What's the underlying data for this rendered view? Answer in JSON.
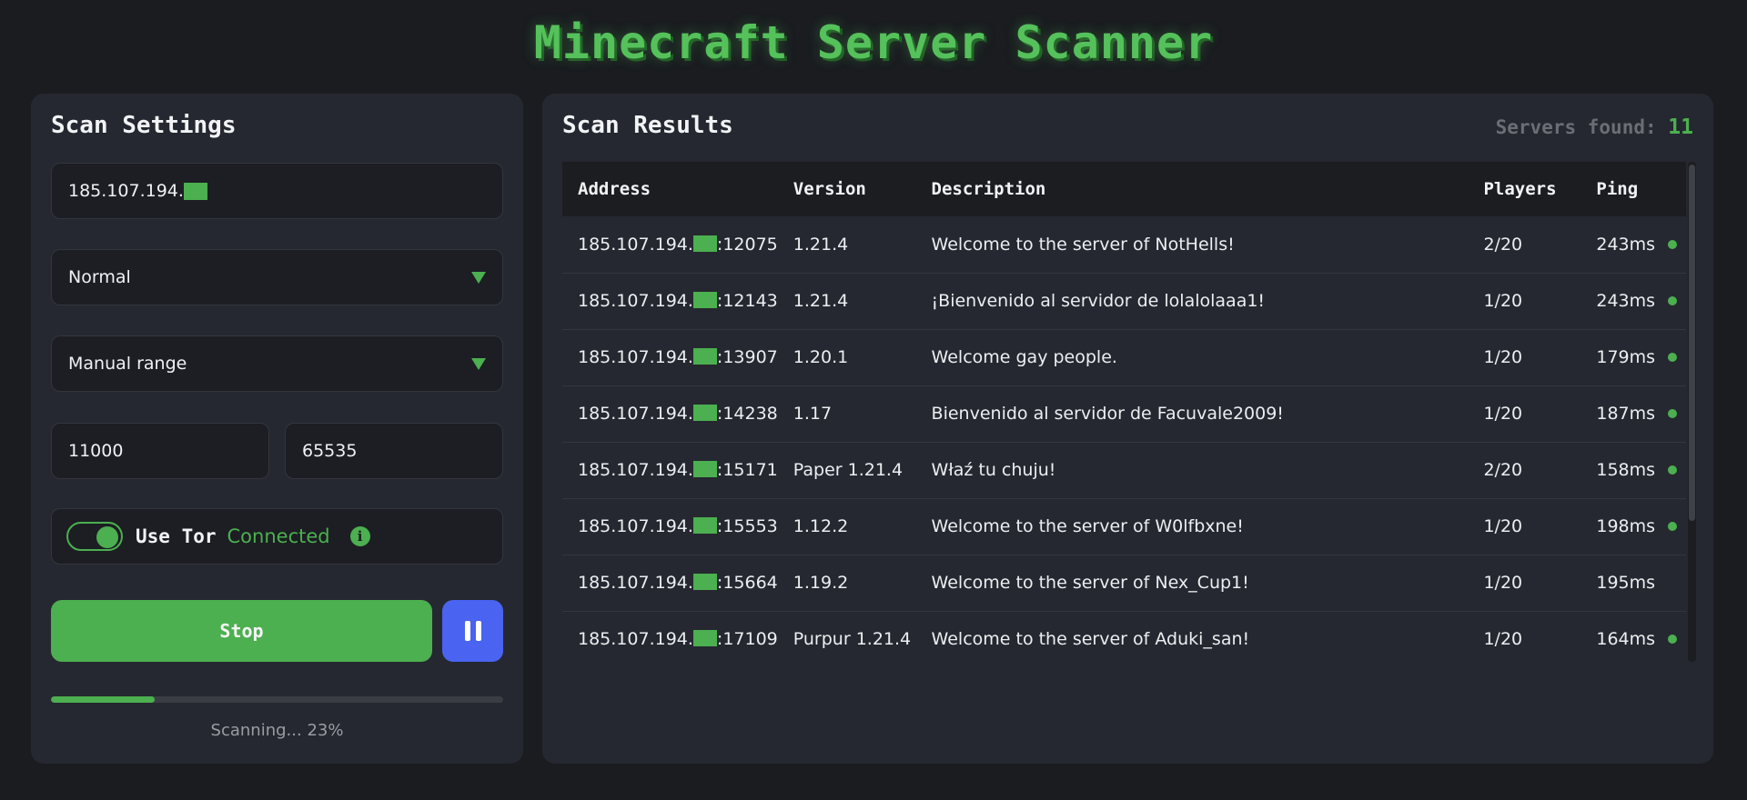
{
  "app": {
    "title": "Minecraft Server Scanner"
  },
  "settings": {
    "title": "Scan Settings",
    "ip_prefix": "185.107.194.",
    "mode": "Normal",
    "range_mode": "Manual range",
    "port_start": "11000",
    "port_end": "65535",
    "tor": {
      "label": "Use Tor",
      "status": "Connected",
      "enabled": true,
      "info_icon": "info-icon"
    },
    "stop_label": "Stop",
    "pause_icon": "pause-icon",
    "progress": {
      "percent": 23,
      "text": "Scanning... 23%"
    }
  },
  "results": {
    "title": "Scan Results",
    "found_label": "Servers found:",
    "found_count": "11",
    "columns": [
      "Address",
      "Version",
      "Description",
      "Players",
      "Ping"
    ],
    "rows": [
      {
        "addr_prefix": "185.107.194.",
        "port": ":12075",
        "version": "1.21.4",
        "description": "Welcome to the server of NotHells!",
        "players": "2/20",
        "ping": "243ms",
        "online": true
      },
      {
        "addr_prefix": "185.107.194.",
        "port": ":12143",
        "version": "1.21.4",
        "description": "¡Bienvenido al servidor de lolalolaaa1!",
        "players": "1/20",
        "ping": "243ms",
        "online": true
      },
      {
        "addr_prefix": "185.107.194.",
        "port": ":13907",
        "version": "1.20.1",
        "description": "Welcome gay people.",
        "players": "1/20",
        "ping": "179ms",
        "online": true
      },
      {
        "addr_prefix": "185.107.194.",
        "port": ":14238",
        "version": "1.17",
        "description": "Bienvenido al servidor de Facuvale2009!",
        "players": "1/20",
        "ping": "187ms",
        "online": true
      },
      {
        "addr_prefix": "185.107.194.",
        "port": ":15171",
        "version": "Paper 1.21.4",
        "description": "Właź tu chuju!",
        "players": "2/20",
        "ping": "158ms",
        "online": true
      },
      {
        "addr_prefix": "185.107.194.",
        "port": ":15553",
        "version": "1.12.2",
        "description": "Welcome to the server of W0lfbxne!",
        "players": "1/20",
        "ping": "198ms",
        "online": true
      },
      {
        "addr_prefix": "185.107.194.",
        "port": ":15664",
        "version": "1.19.2",
        "description": "Welcome to the server of Nex_Cup1!",
        "players": "1/20",
        "ping": "195ms",
        "online": false
      },
      {
        "addr_prefix": "185.107.194.",
        "port": ":17109",
        "version": "Purpur 1.21.4",
        "description": "Welcome to the server of Aduki_san!",
        "players": "1/20",
        "ping": "164ms",
        "online": true
      }
    ]
  },
  "colors": {
    "accent": "#4caf50",
    "pause": "#4a63f0",
    "background": "#1a1c20",
    "panel": "#252830"
  }
}
